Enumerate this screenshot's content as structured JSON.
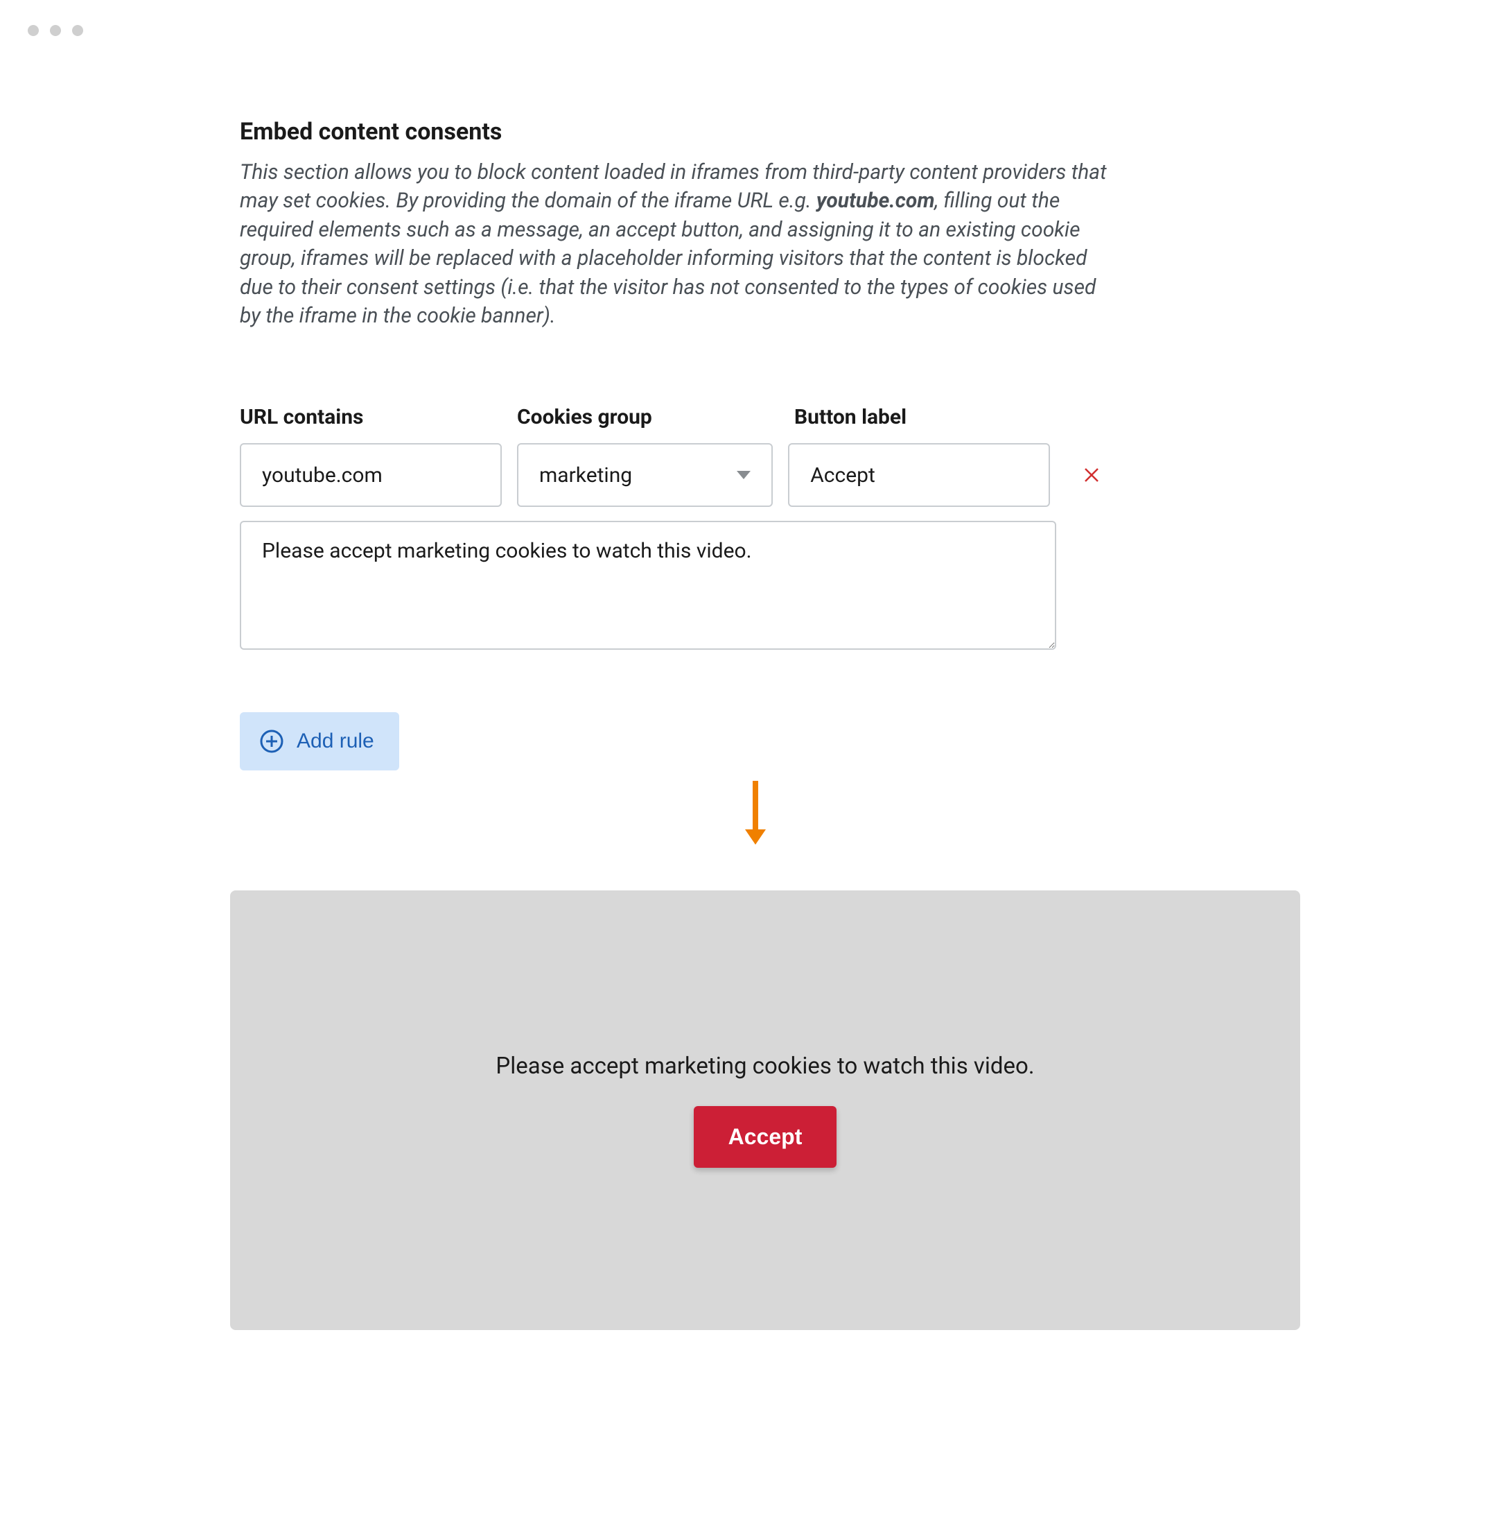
{
  "header": {
    "title": "Embed content consents",
    "description_pre": "This section allows you to block content loaded in iframes from third-party content providers that may set cookies. By providing the domain of the iframe URL e.g. ",
    "description_bold": "youtube.com",
    "description_post": ", filling out the required elements such as a message, an accept button, and assigning it to an existing cookie group, iframes will be replaced with a placeholder informing visitors that the content is blocked due to their consent settings (i.e. that the visitor has not consented to the types of cookies used by the iframe in the cookie banner)."
  },
  "form": {
    "labels": {
      "url_contains": "URL contains",
      "cookies_group": "Cookies group",
      "button_label": "Button label"
    },
    "values": {
      "url_contains": "youtube.com",
      "cookies_group": "marketing",
      "button_label": "Accept",
      "message": "Please accept marketing cookies to watch this video."
    },
    "add_rule_label": "Add rule"
  },
  "preview": {
    "message": "Please accept marketing cookies to watch this video.",
    "button_label": "Accept"
  }
}
